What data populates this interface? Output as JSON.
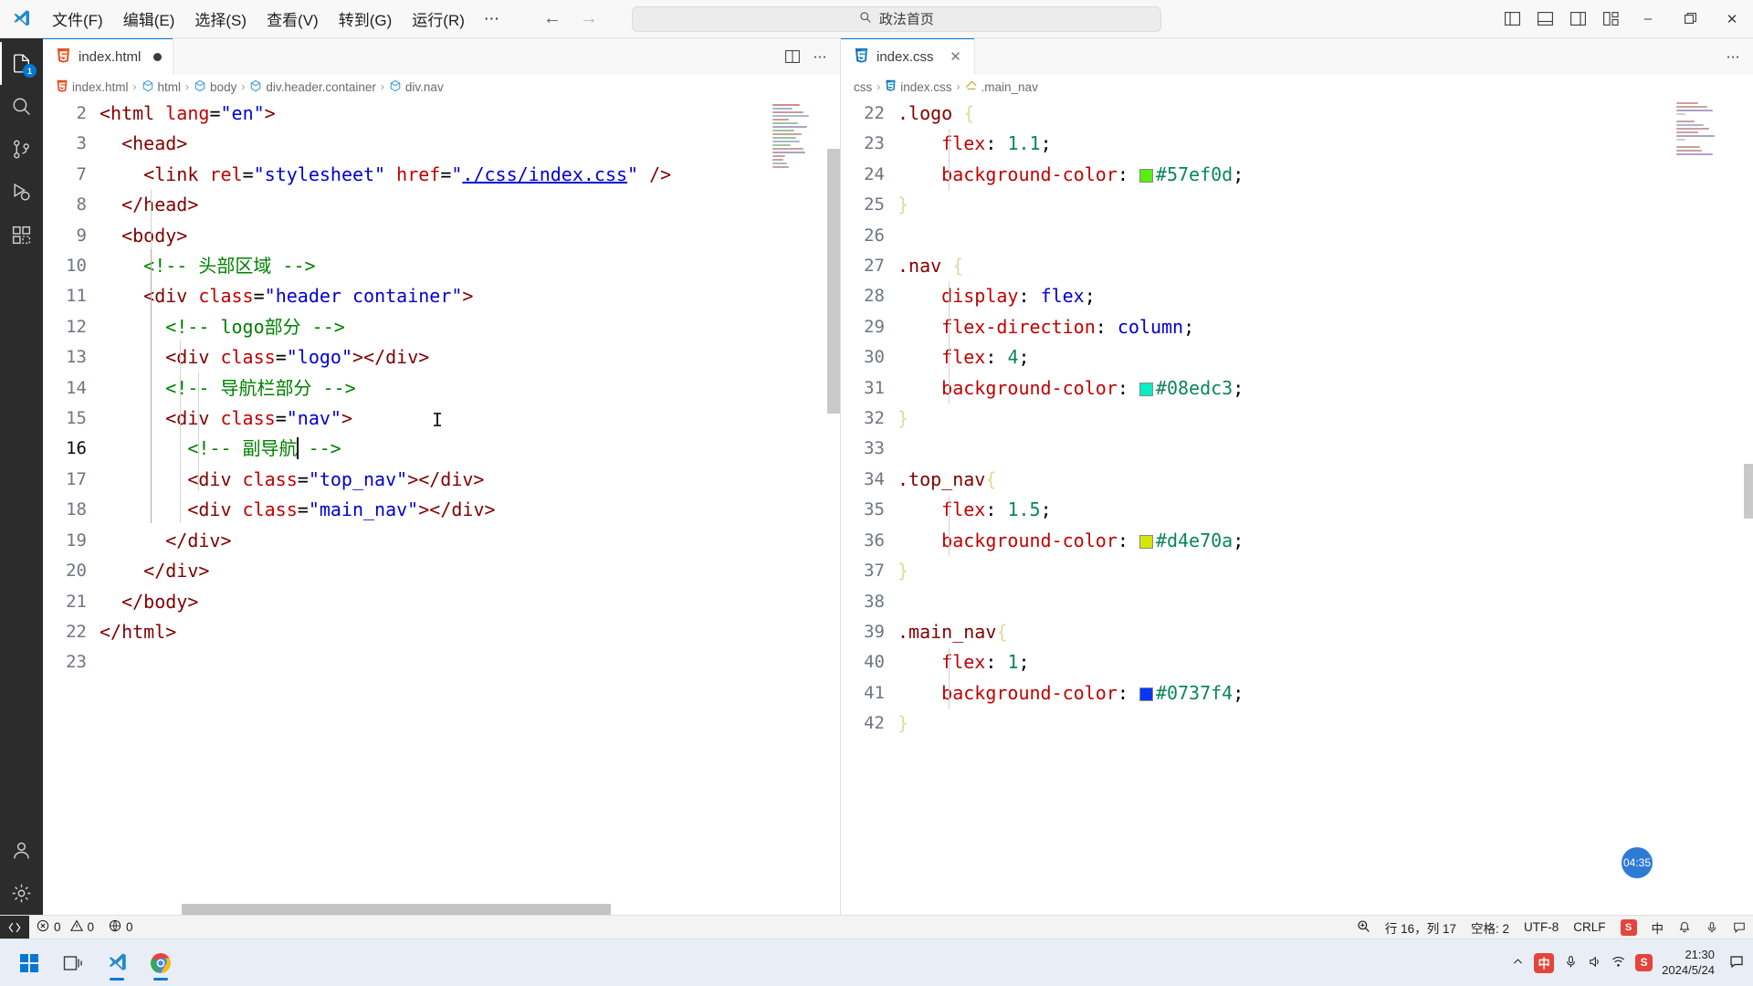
{
  "titlebar": {
    "menus": [
      "文件(F)",
      "编辑(E)",
      "选择(S)",
      "查看(V)",
      "转到(G)",
      "运行(R)"
    ],
    "more": "⋯",
    "back_icon": "arrow-left-icon",
    "forward_icon": "arrow-right-icon",
    "command_center_text": "政法首页",
    "command_center_icon": "search-icon",
    "layout_icons": [
      "toggle-primary-sidebar-icon",
      "toggle-panel-icon",
      "toggle-secondary-sidebar-icon",
      "customize-layout-icon"
    ],
    "window_minimize": "–",
    "window_maximize": "❐",
    "window_close": "✕"
  },
  "activitybar": {
    "items": [
      {
        "name": "explorer",
        "badge": "1"
      },
      {
        "name": "search",
        "badge": ""
      },
      {
        "name": "source-control",
        "badge": ""
      },
      {
        "name": "run-and-debug",
        "badge": ""
      },
      {
        "name": "extensions",
        "badge": ""
      }
    ],
    "bottom": [
      {
        "name": "accounts"
      },
      {
        "name": "settings"
      }
    ]
  },
  "left_editor": {
    "tab": {
      "label": "index.html",
      "icon": "html5-file-icon",
      "dirty": true
    },
    "actions": [
      "split-editor-icon",
      "more-actions-icon"
    ],
    "breadcrumb": [
      "index.html",
      "html",
      "body",
      "div.header.container",
      "div.nav"
    ],
    "lines": [
      {
        "num": "2",
        "active": false
      },
      {
        "num": "3",
        "active": false
      },
      {
        "num": "7",
        "active": false
      },
      {
        "num": "8",
        "active": false
      },
      {
        "num": "9",
        "active": false
      },
      {
        "num": "10",
        "active": false
      },
      {
        "num": "11",
        "active": false
      },
      {
        "num": "12",
        "active": false
      },
      {
        "num": "13",
        "active": false
      },
      {
        "num": "14",
        "active": false
      },
      {
        "num": "15",
        "active": false
      },
      {
        "num": "16",
        "active": true
      },
      {
        "num": "17",
        "active": false
      },
      {
        "num": "18",
        "active": false
      },
      {
        "num": "19",
        "active": false
      },
      {
        "num": "20",
        "active": false
      },
      {
        "num": "21",
        "active": false
      },
      {
        "num": "22",
        "active": false
      },
      {
        "num": "23",
        "active": false
      }
    ],
    "code": [
      "<html lang=\"en\">",
      "  <head>",
      "    <link rel=\"stylesheet\" href=\"./css/index.css\" />",
      "  </head>",
      "  <body>",
      "    <!-- 头部区域 -->",
      "    <div class=\"header container\">",
      "      <!-- logo部分 -->",
      "      <div class=\"logo\"></div>",
      "      <!-- 导航栏部分 -->",
      "      <div class=\"nav\">",
      "        <!-- 副导航 -->",
      "        <div class=\"top_nav\"></div>",
      "        <div class=\"main_nav\"></div>",
      "      </div>",
      "    </div>",
      "  </body>",
      "</html>",
      ""
    ]
  },
  "right_editor": {
    "tab": {
      "label": "index.css",
      "icon": "css3-file-icon",
      "close_icon": "close-icon"
    },
    "actions": [
      "more-actions-icon"
    ],
    "breadcrumb": [
      "css",
      "index.css",
      ".main_nav"
    ],
    "lines": [
      {
        "num": "22"
      },
      {
        "num": "23"
      },
      {
        "num": "24"
      },
      {
        "num": "25"
      },
      {
        "num": "26"
      },
      {
        "num": "27"
      },
      {
        "num": "28"
      },
      {
        "num": "29"
      },
      {
        "num": "30"
      },
      {
        "num": "31"
      },
      {
        "num": "32"
      },
      {
        "num": "33"
      },
      {
        "num": "34"
      },
      {
        "num": "35"
      },
      {
        "num": "36"
      },
      {
        "num": "37"
      },
      {
        "num": "38"
      },
      {
        "num": "39"
      },
      {
        "num": "40"
      },
      {
        "num": "41"
      },
      {
        "num": "42"
      }
    ],
    "rules": {
      "logo": {
        "selector": ".logo",
        "flex": "1.1",
        "color": "#57ef0d"
      },
      "nav": {
        "selector": ".nav",
        "display": "flex",
        "flex_direction": "column",
        "flex": "4",
        "color": "#08edc3"
      },
      "top_nav": {
        "selector": ".top_nav",
        "flex": "1.5",
        "color": "#d4e70a"
      },
      "main_nav": {
        "selector": ".main_nav",
        "flex": "1",
        "color": "#0737f4"
      }
    },
    "timer_badge": "04:35"
  },
  "statusbar": {
    "remote_icon": "remote-window-icon",
    "errors_icon": "error-icon",
    "errors": "0",
    "warnings_icon": "warning-icon",
    "warnings": "0",
    "ports_icon": "ports-icon",
    "ports": "0",
    "zoom_icon": "magnifier-icon",
    "cursor_position": "行 16，列 17",
    "indentation": "空格: 2",
    "encoding": "UTF-8",
    "eol": "CRLF",
    "language_icon": "sogou-icon",
    "ime_mode": "中",
    "bell_icon": "bell-icon",
    "mic_icon": "microphone-icon",
    "feedback_icon": "feedback-icon"
  },
  "taskbar": {
    "start_icon": "windows-start-icon",
    "task_view_icon": "task-view-icon",
    "apps": [
      {
        "name": "vscode-taskbar-icon",
        "active": true
      },
      {
        "name": "chrome-taskbar-icon",
        "active": true
      }
    ],
    "tray": {
      "chevron_up_icon": "chevron-up-icon",
      "ime_badge": "中",
      "mic_icon": "microphone-icon",
      "volume_icon": "volume-icon",
      "network_icon": "network-icon",
      "sogou_icon": "sogou-pinyin-icon",
      "notification_icon": "notification-icon"
    },
    "time": "21:30",
    "date": "2024/5/24"
  }
}
